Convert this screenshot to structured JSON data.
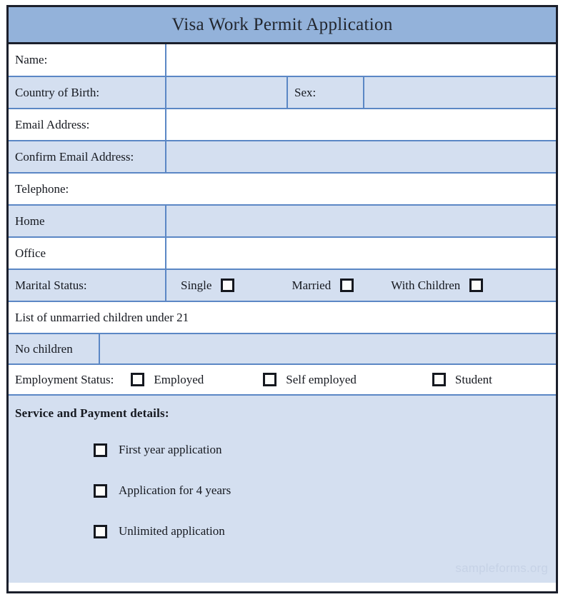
{
  "header": {
    "title": "Visa Work Permit Application"
  },
  "fields": {
    "name_label": "Name:",
    "name_value": "",
    "country_label": "Country of Birth:",
    "country_value": "",
    "sex_label": "Sex:",
    "sex_value": "",
    "email_label": "Email Address:",
    "email_value": "",
    "confirm_email_label": "Confirm Email Address:",
    "confirm_email_value": "",
    "telephone_label": "Telephone:",
    "home_label": "Home",
    "home_value": "",
    "office_label": "Office",
    "office_value": ""
  },
  "marital": {
    "label": "Marital Status:",
    "options": [
      {
        "label": "Single",
        "checked": false
      },
      {
        "label": "Married",
        "checked": false
      },
      {
        "label": "With Children",
        "checked": false
      }
    ]
  },
  "children": {
    "list_label": "List of unmarried children under 21",
    "list_value": "",
    "no_children_label": "No children",
    "no_children_value": ""
  },
  "employment": {
    "label": "Employment Status:",
    "options": [
      {
        "label": "Employed",
        "checked": false
      },
      {
        "label": "Self employed",
        "checked": false
      },
      {
        "label": "Student",
        "checked": false
      }
    ]
  },
  "payment": {
    "title": "Service and Payment details:",
    "options": [
      {
        "label": "First year application",
        "checked": false
      },
      {
        "label": "Application for 4 years",
        "checked": false
      },
      {
        "label": "Unlimited application",
        "checked": false
      }
    ]
  },
  "watermark": "sampleforms.org",
  "colors": {
    "header_blue": "#93b2da",
    "row_blue": "#d4dff0",
    "grid_blue": "#5b87c5",
    "frame_dark": "#1b1f2b",
    "text": "#15181f",
    "watermark": "#c6d2e6"
  }
}
